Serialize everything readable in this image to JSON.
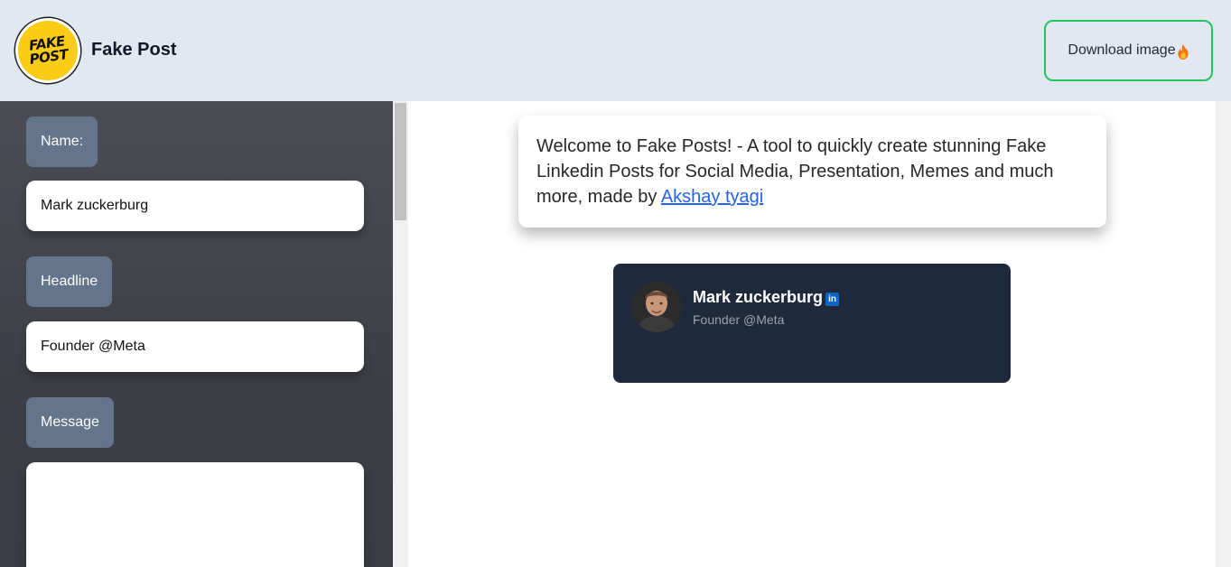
{
  "header": {
    "logo_text": "FAKE POST",
    "app_title": "Fake Post",
    "download_label": "Download image",
    "download_icon": "flame-icon",
    "accent_color": "#22c55e"
  },
  "sidebar": {
    "name_label": "Name:",
    "name_value": "Mark zuckerburg",
    "headline_label": "Headline",
    "headline_value": "Founder @Meta",
    "message_label": "Message",
    "message_value": ""
  },
  "welcome": {
    "text": "Welcome to Fake Posts! - A tool to quickly create stunning Fake Linkedin Posts for Social Media, Presentation, Memes and much more, made by ",
    "link_text": "Akshay tyagi"
  },
  "post": {
    "name": "Mark zuckerburg",
    "badge": "in",
    "headline": "Founder @Meta",
    "card_color": "#1e293b"
  }
}
